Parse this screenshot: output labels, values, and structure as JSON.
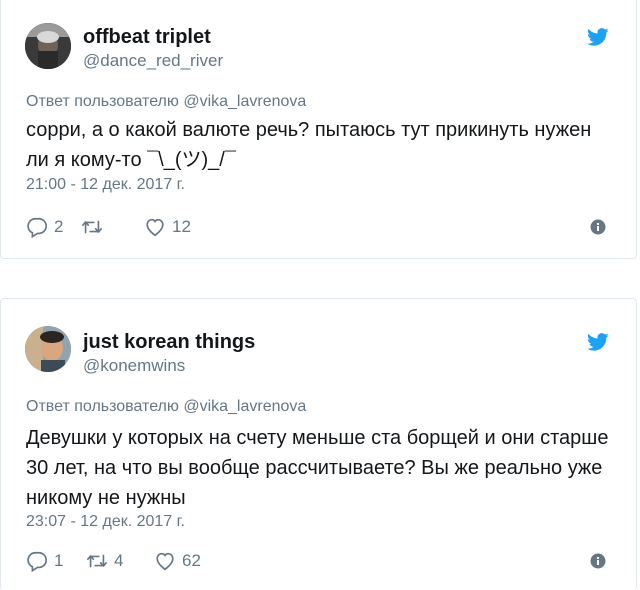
{
  "colors": {
    "twitter_blue": "#1da1f2",
    "text": "#14171a",
    "secondary": "#657786",
    "border": "#e1e8ed"
  },
  "tweets": [
    {
      "display_name": "offbeat triplet",
      "handle": "@dance_red_river",
      "reply_to": "Ответ пользователю @vika_lavrenova",
      "text": "сорри, а о какой валюте речь? пытаюсь тут прикинуть нужен ли я кому-то ¯\\_(ツ)_/¯",
      "timestamp": "21:00 - 12 дек. 2017 г.",
      "reply_count": "2",
      "retweet_count": "",
      "like_count": "12",
      "icons": [
        "avatar",
        "twitter-bird-icon",
        "reply-icon",
        "retweet-icon",
        "heart-icon",
        "info-icon"
      ]
    },
    {
      "display_name": "just korean things",
      "handle": "@konemwins",
      "reply_to": "Ответ пользователю @vika_lavrenova",
      "text": "Девушки у которых на счету меньше ста борщей и они старше 30 лет, на что вы вообще рассчитываете? Вы же реально уже никому не нужны",
      "timestamp": "23:07 - 12 дек. 2017 г.",
      "reply_count": "1",
      "retweet_count": "4",
      "like_count": "62",
      "icons": [
        "avatar",
        "twitter-bird-icon",
        "reply-icon",
        "retweet-icon",
        "heart-icon",
        "info-icon"
      ]
    }
  ]
}
